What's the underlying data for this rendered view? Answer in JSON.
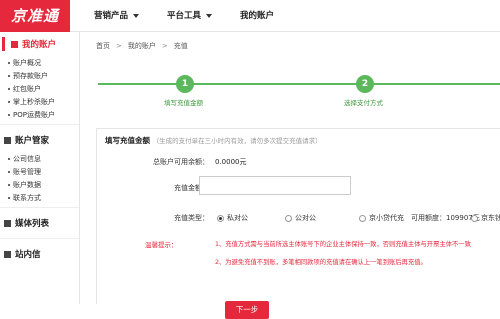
{
  "header": {
    "logo_text": "京准通",
    "nav": [
      {
        "label": "营销产品",
        "dropdown": true
      },
      {
        "label": "平台工具",
        "dropdown": true
      },
      {
        "label": "我的账户",
        "dropdown": false
      }
    ]
  },
  "sidebar": {
    "sections": [
      {
        "title": "我的账户",
        "active": true,
        "items": [
          "账户概况",
          "预存款账户",
          "红包账户",
          "掌上秒杀账户",
          "POP运费账户"
        ]
      },
      {
        "title": "账户管家",
        "active": false,
        "items": [
          "公司信息",
          "账号管理",
          "账户数据",
          "联系方式"
        ]
      },
      {
        "title": "媒体列表",
        "active": false,
        "items": []
      },
      {
        "title": "站内信",
        "active": false,
        "items": []
      }
    ]
  },
  "breadcrumb": [
    "首页",
    "我的账户",
    "充值"
  ],
  "steps": [
    {
      "number": "1",
      "label": "填写充值金额"
    },
    {
      "number": "2",
      "label": "选择支付方式"
    }
  ],
  "form": {
    "title": "填写充值金额",
    "title_note": "（生成的支付单在三小时内有效，请勿多次提交充值请求）",
    "balance_label": "总账户可用余额：",
    "balance_value": "0.0000元",
    "amount_label": "充值金额：",
    "amount_value": "",
    "type_label": "充值类型：",
    "types": [
      {
        "label": "私对公",
        "selected": true
      },
      {
        "label": "公对公",
        "selected": false
      },
      {
        "label": "京小贷代充",
        "selected": false
      },
      {
        "label": "京东钱包",
        "selected": false
      }
    ],
    "credit_label": "可用额度：",
    "credit_value": "109907元",
    "warning_label": "温馨提示：",
    "warnings": [
      "1、充值方式需与当前所选主体账号下的企业主体保持一致，否则充值主体与开票主体不一致",
      "2、为避免充值不到账，多笔相同款项的充值请在确认上一笔到账后再充值。"
    ],
    "next_label": "下一步"
  },
  "colors": {
    "brand_red": "#e6283c",
    "step_green": "#5cb85c"
  }
}
